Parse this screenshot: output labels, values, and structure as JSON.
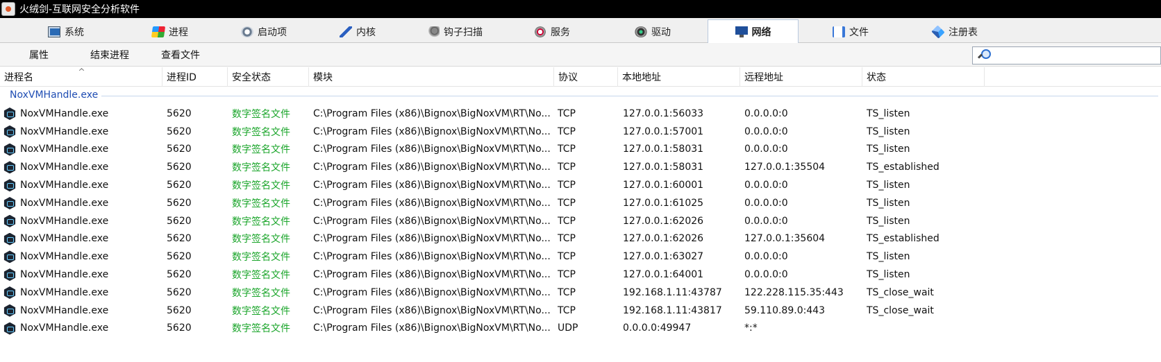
{
  "window": {
    "title": "火绒剑-互联网安全分析软件"
  },
  "tabs": [
    {
      "label": "系统",
      "icon": "system-icon"
    },
    {
      "label": "进程",
      "icon": "process-icon"
    },
    {
      "label": "启动项",
      "icon": "startup-icon"
    },
    {
      "label": "内核",
      "icon": "kernel-icon"
    },
    {
      "label": "钩子扫描",
      "icon": "hook-scan-icon"
    },
    {
      "label": "服务",
      "icon": "service-icon"
    },
    {
      "label": "驱动",
      "icon": "driver-icon"
    },
    {
      "label": "网络",
      "icon": "network-icon",
      "active": true
    },
    {
      "label": "文件",
      "icon": "file-icon"
    },
    {
      "label": "注册表",
      "icon": "registry-icon"
    }
  ],
  "toolbar": {
    "properties": "属性",
    "end_process": "结束进程",
    "view_file": "查看文件",
    "search_placeholder": ""
  },
  "columns": {
    "process_name": "进程名",
    "pid": "进程ID",
    "security": "安全状态",
    "module": "模块",
    "protocol": "协议",
    "local": "本地地址",
    "remote": "远程地址",
    "state": "状态"
  },
  "group": {
    "label": "NoxVMHandle.exe"
  },
  "rows": [
    {
      "name": "NoxVMHandle.exe",
      "pid": "5620",
      "security": "数字签名文件",
      "module": "C:\\Program Files (x86)\\Bignox\\BigNoxVM\\RT\\No...",
      "protocol": "TCP",
      "local": "127.0.0.1:56033",
      "remote": "0.0.0.0:0",
      "state": "TS_listen"
    },
    {
      "name": "NoxVMHandle.exe",
      "pid": "5620",
      "security": "数字签名文件",
      "module": "C:\\Program Files (x86)\\Bignox\\BigNoxVM\\RT\\No...",
      "protocol": "TCP",
      "local": "127.0.0.1:57001",
      "remote": "0.0.0.0:0",
      "state": "TS_listen"
    },
    {
      "name": "NoxVMHandle.exe",
      "pid": "5620",
      "security": "数字签名文件",
      "module": "C:\\Program Files (x86)\\Bignox\\BigNoxVM\\RT\\No...",
      "protocol": "TCP",
      "local": "127.0.0.1:58031",
      "remote": "0.0.0.0:0",
      "state": "TS_listen"
    },
    {
      "name": "NoxVMHandle.exe",
      "pid": "5620",
      "security": "数字签名文件",
      "module": "C:\\Program Files (x86)\\Bignox\\BigNoxVM\\RT\\No...",
      "protocol": "TCP",
      "local": "127.0.0.1:58031",
      "remote": "127.0.0.1:35504",
      "state": "TS_established"
    },
    {
      "name": "NoxVMHandle.exe",
      "pid": "5620",
      "security": "数字签名文件",
      "module": "C:\\Program Files (x86)\\Bignox\\BigNoxVM\\RT\\No...",
      "protocol": "TCP",
      "local": "127.0.0.1:60001",
      "remote": "0.0.0.0:0",
      "state": "TS_listen"
    },
    {
      "name": "NoxVMHandle.exe",
      "pid": "5620",
      "security": "数字签名文件",
      "module": "C:\\Program Files (x86)\\Bignox\\BigNoxVM\\RT\\No...",
      "protocol": "TCP",
      "local": "127.0.0.1:61025",
      "remote": "0.0.0.0:0",
      "state": "TS_listen"
    },
    {
      "name": "NoxVMHandle.exe",
      "pid": "5620",
      "security": "数字签名文件",
      "module": "C:\\Program Files (x86)\\Bignox\\BigNoxVM\\RT\\No...",
      "protocol": "TCP",
      "local": "127.0.0.1:62026",
      "remote": "0.0.0.0:0",
      "state": "TS_listen"
    },
    {
      "name": "NoxVMHandle.exe",
      "pid": "5620",
      "security": "数字签名文件",
      "module": "C:\\Program Files (x86)\\Bignox\\BigNoxVM\\RT\\No...",
      "protocol": "TCP",
      "local": "127.0.0.1:62026",
      "remote": "127.0.0.1:35604",
      "state": "TS_established"
    },
    {
      "name": "NoxVMHandle.exe",
      "pid": "5620",
      "security": "数字签名文件",
      "module": "C:\\Program Files (x86)\\Bignox\\BigNoxVM\\RT\\No...",
      "protocol": "TCP",
      "local": "127.0.0.1:63027",
      "remote": "0.0.0.0:0",
      "state": "TS_listen"
    },
    {
      "name": "NoxVMHandle.exe",
      "pid": "5620",
      "security": "数字签名文件",
      "module": "C:\\Program Files (x86)\\Bignox\\BigNoxVM\\RT\\No...",
      "protocol": "TCP",
      "local": "127.0.0.1:64001",
      "remote": "0.0.0.0:0",
      "state": "TS_listen"
    },
    {
      "name": "NoxVMHandle.exe",
      "pid": "5620",
      "security": "数字签名文件",
      "module": "C:\\Program Files (x86)\\Bignox\\BigNoxVM\\RT\\No...",
      "protocol": "TCP",
      "local": "192.168.1.11:43787",
      "remote": "122.228.115.35:443",
      "state": "TS_close_wait"
    },
    {
      "name": "NoxVMHandle.exe",
      "pid": "5620",
      "security": "数字签名文件",
      "module": "C:\\Program Files (x86)\\Bignox\\BigNoxVM\\RT\\No...",
      "protocol": "TCP",
      "local": "192.168.1.11:43817",
      "remote": "59.110.89.0:443",
      "state": "TS_close_wait"
    },
    {
      "name": "NoxVMHandle.exe",
      "pid": "5620",
      "security": "数字签名文件",
      "module": "C:\\Program Files (x86)\\Bignox\\BigNoxVM\\RT\\No...",
      "protocol": "UDP",
      "local": "0.0.0.0:49947",
      "remote": "*:*",
      "state": ""
    }
  ]
}
